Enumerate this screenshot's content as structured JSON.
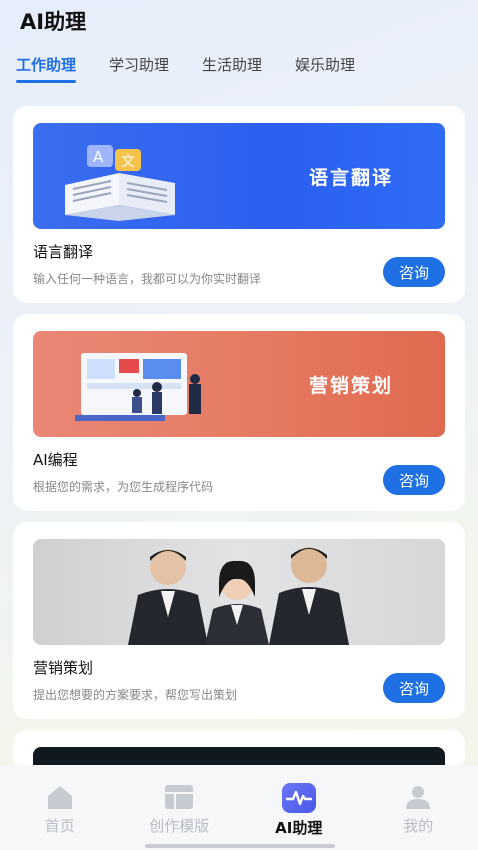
{
  "header": {
    "title": "AI助理",
    "tabs": [
      {
        "label": "工作助理"
      },
      {
        "label": "学习助理"
      },
      {
        "label": "生活助理"
      },
      {
        "label": "娱乐助理"
      }
    ]
  },
  "cards": [
    {
      "banner_text": "语言翻译",
      "title": "语言翻译",
      "desc": "输入任何一种语言，我都可以为你实时翻译",
      "button": "咨询"
    },
    {
      "banner_text": "营销策划",
      "title": "AI编程",
      "desc": "根据您的需求，为您生成程序代码",
      "button": "咨询"
    },
    {
      "banner_text": "",
      "title": "营销策划",
      "desc": "提出您想要的方案要求，帮您写出策划",
      "button": "咨询"
    }
  ],
  "bottom_nav": [
    {
      "label": "首页",
      "icon": "home-icon"
    },
    {
      "label": "创作模版",
      "icon": "template-icon"
    },
    {
      "label": "AI助理",
      "icon": "pulse-icon"
    },
    {
      "label": "我的",
      "icon": "profile-icon"
    }
  ],
  "colors": {
    "accent": "#1f6fe5",
    "banner_blue": "#2b5ff0",
    "banner_orange": "#e57a62"
  }
}
